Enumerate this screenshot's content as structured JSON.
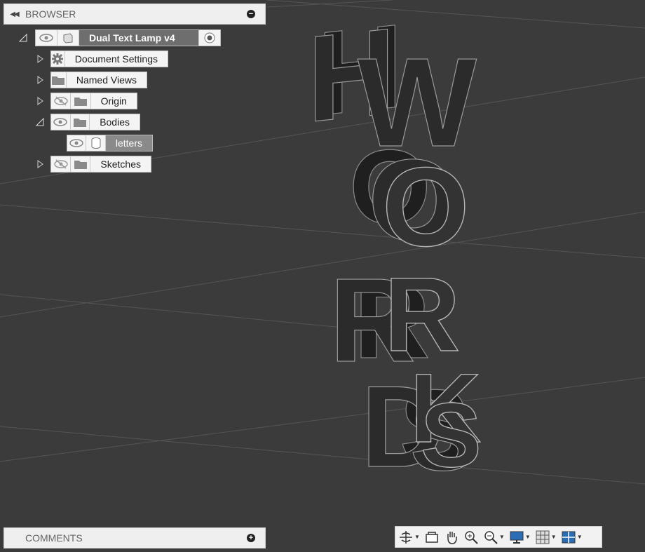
{
  "browser": {
    "title": "BROWSER",
    "root": {
      "label": "Dual Text Lamp v4"
    },
    "items": [
      {
        "label": "Document Settings"
      },
      {
        "label": "Named Views"
      },
      {
        "label": "Origin"
      },
      {
        "label": "Bodies"
      },
      {
        "label": "letters"
      },
      {
        "label": "Sketches"
      }
    ]
  },
  "comments": {
    "title": "COMMENTS"
  },
  "toolbar": {
    "buttons": [
      "orbit-icon",
      "look-at-icon",
      "pan-icon",
      "zoom-window-icon",
      "zoom-icon",
      "display-settings-icon",
      "grid-icon",
      "viewports-icon"
    ]
  },
  "colors": {
    "background": "#3b3b3b",
    "panel": "#efefef",
    "selected": "#6e6e6e"
  }
}
